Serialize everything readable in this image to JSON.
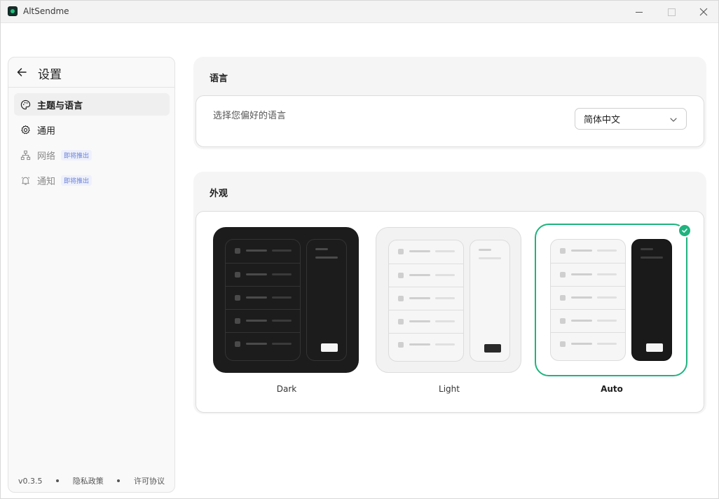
{
  "window": {
    "title": "AltSendme"
  },
  "sidebar": {
    "title": "设置",
    "items": [
      {
        "label": "主题与语言",
        "icon": "palette-icon",
        "active": true
      },
      {
        "label": "通用",
        "icon": "gear-icon"
      },
      {
        "label": "网络",
        "icon": "network-icon",
        "badge": "即将推出"
      },
      {
        "label": "通知",
        "icon": "bell-icon",
        "badge": "即将推出"
      }
    ],
    "footer": {
      "version": "v0.3.5",
      "privacy": "隐私政策",
      "license": "许可协议"
    }
  },
  "language": {
    "title": "语言",
    "description": "选择您偏好的语言",
    "selected": "简体中文"
  },
  "appearance": {
    "title": "外观",
    "options": [
      {
        "label": "Dark"
      },
      {
        "label": "Light"
      },
      {
        "label": "Auto",
        "selected": true
      }
    ]
  },
  "colors": {
    "accent": "#1fb37f",
    "badge": "#6a7fd6"
  }
}
